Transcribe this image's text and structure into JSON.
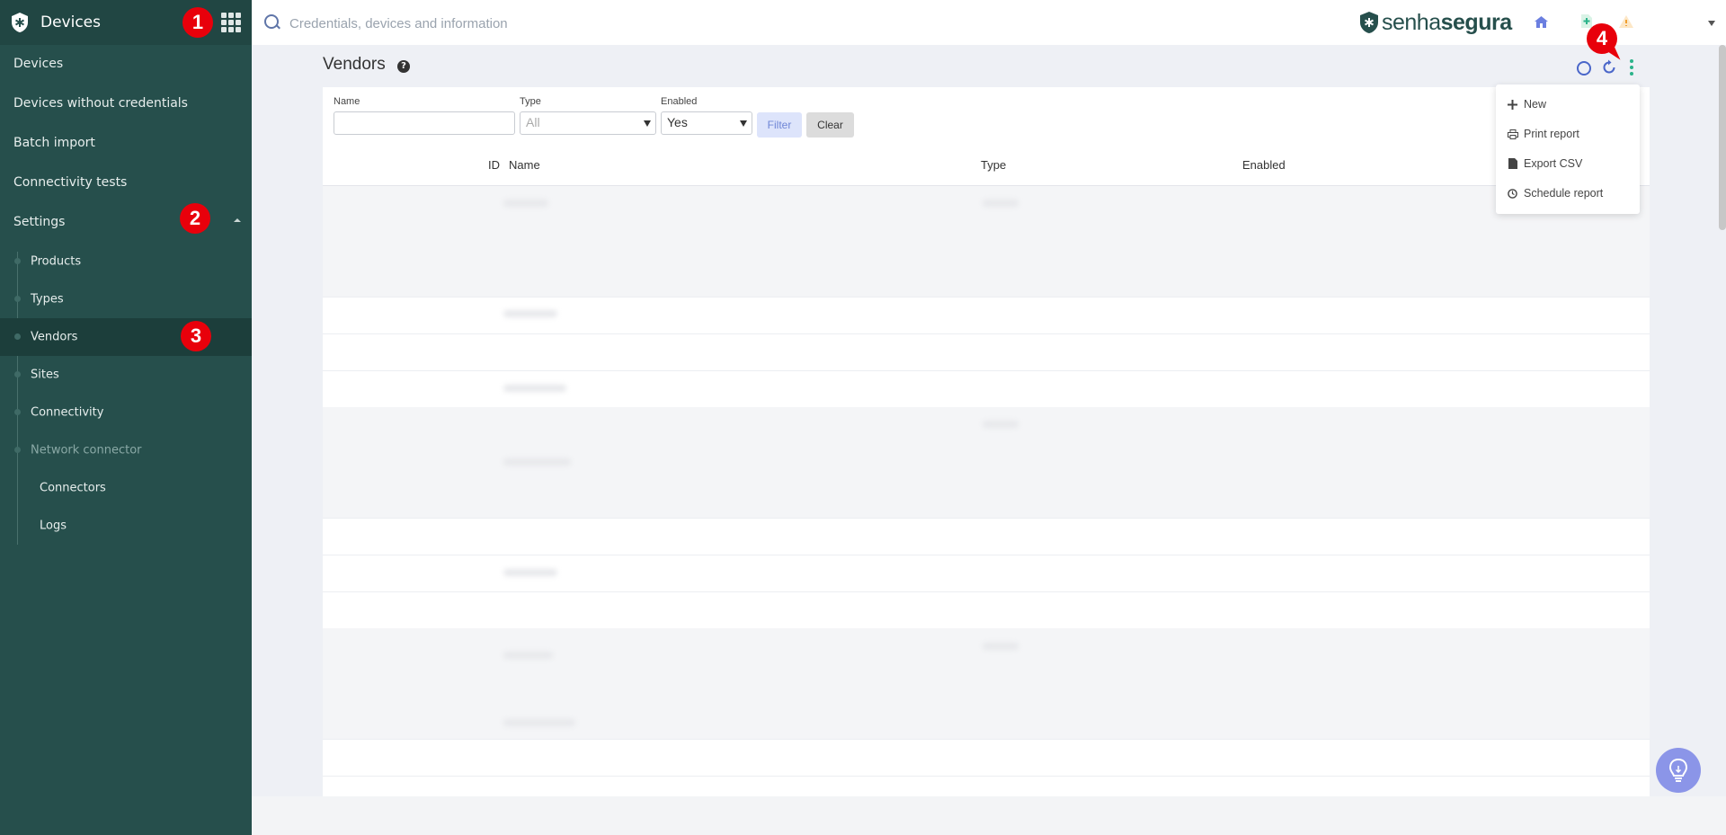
{
  "sidebar": {
    "title": "Devices",
    "items": [
      {
        "label": "Devices"
      },
      {
        "label": "Devices without credentials"
      },
      {
        "label": "Batch import"
      },
      {
        "label": "Connectivity tests"
      },
      {
        "label": "Settings"
      }
    ],
    "settings_items": [
      {
        "label": "Products"
      },
      {
        "label": "Types"
      },
      {
        "label": "Vendors"
      },
      {
        "label": "Sites"
      },
      {
        "label": "Connectivity"
      },
      {
        "label": "Network connector"
      }
    ],
    "network_items": [
      {
        "label": "Connectors"
      },
      {
        "label": "Logs"
      }
    ]
  },
  "topbar": {
    "search_placeholder": "Credentials, devices and information",
    "brand_pre": "senha",
    "brand_post": "segura"
  },
  "page": {
    "title": "Vendors",
    "help": "?"
  },
  "filters": {
    "name_label": "Name",
    "name_value": "",
    "type_label": "Type",
    "type_value": "All",
    "enabled_label": "Enabled",
    "enabled_value": "Yes",
    "filter_button": "Filter",
    "clear_button": "Clear"
  },
  "table": {
    "columns": [
      "ID",
      "Name",
      "Type",
      "Enabled"
    ]
  },
  "dropdown": {
    "items": [
      {
        "label": "New",
        "icon": "plus-icon"
      },
      {
        "label": "Print report",
        "icon": "print-icon"
      },
      {
        "label": "Export CSV",
        "icon": "file-icon"
      },
      {
        "label": "Schedule report",
        "icon": "clock-icon"
      }
    ]
  },
  "markers": [
    "1",
    "2",
    "3",
    "4"
  ],
  "colors": {
    "sidebar": "#264f4c",
    "accent": "#2bb38a",
    "marker": "#e8000b",
    "link": "#4a66c9"
  }
}
